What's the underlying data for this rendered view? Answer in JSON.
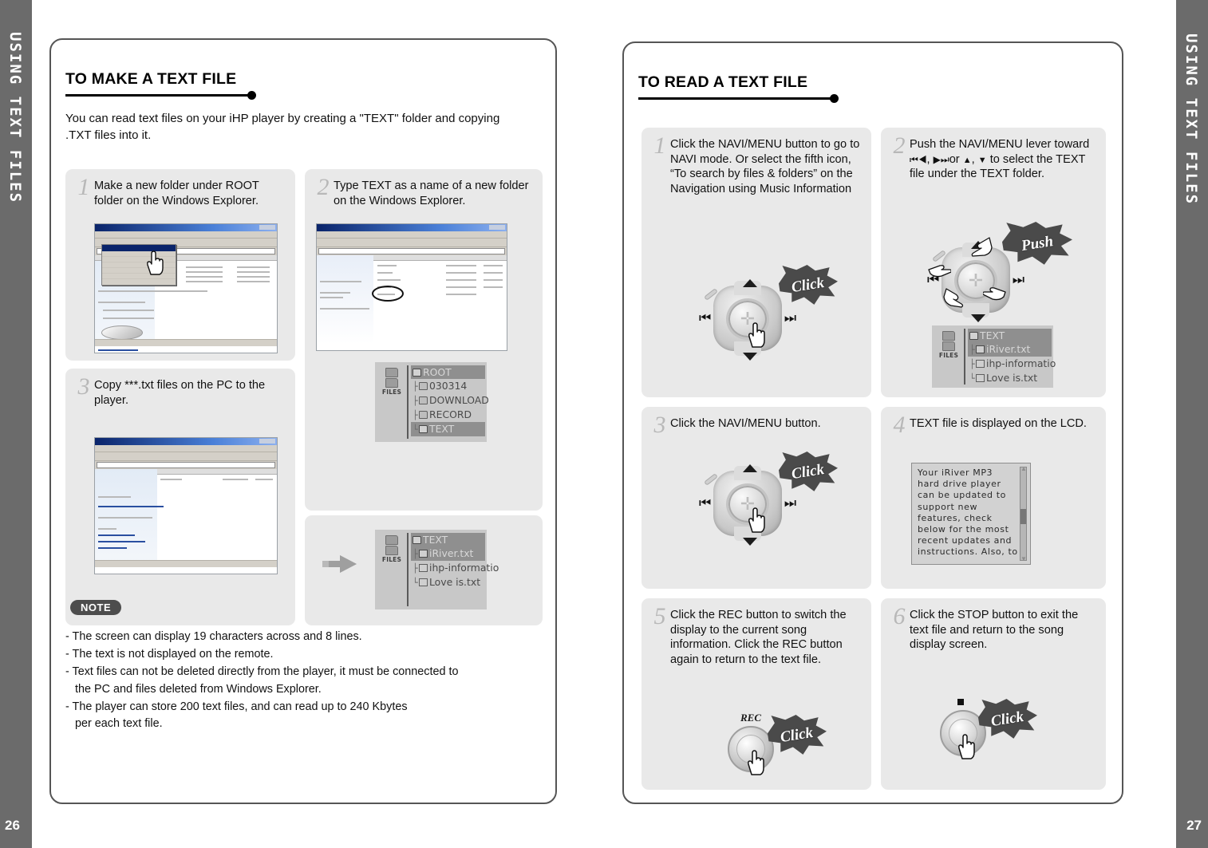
{
  "sidebar": {
    "left_label": "USING TEXT FILES",
    "right_label": "USING TEXT FILES",
    "left_page_number": "26",
    "right_page_number": "27"
  },
  "left_page": {
    "section_title": "TO MAKE A TEXT FILE",
    "intro": "You can read text files on your iHP player by creating a \"TEXT\" folder and copying .TXT files into it.",
    "steps": [
      {
        "num": "1",
        "text": "Make a new folder under ROOT folder on the Windows Explorer."
      },
      {
        "num": "2",
        "text": "Type TEXT as a name of a new folder on the Windows Explorer."
      },
      {
        "num": "3",
        "text": "Copy ***.txt files on the PC to the player."
      }
    ],
    "lcd_root": {
      "files_label": "FILES",
      "rows": [
        {
          "label": "ROOT",
          "selected": true,
          "icon": "folder-open-icon",
          "branch": ""
        },
        {
          "label": "030314",
          "selected": false,
          "icon": "folder-icon",
          "branch": "├"
        },
        {
          "label": "DOWNLOAD",
          "selected": false,
          "icon": "folder-icon",
          "branch": "├"
        },
        {
          "label": "RECORD",
          "selected": false,
          "icon": "folder-icon",
          "branch": "├"
        },
        {
          "label": "TEXT",
          "selected": true,
          "icon": "folder-icon",
          "branch": "└"
        }
      ]
    },
    "lcd_text_folder": {
      "files_label": "FILES",
      "rows": [
        {
          "label": "TEXT",
          "selected": true,
          "icon": "folder-open-icon",
          "branch": ""
        },
        {
          "label": "iRiver.txt",
          "selected": true,
          "icon": "doc-icon",
          "branch": "├"
        },
        {
          "label": "ihp-informatio",
          "selected": false,
          "icon": "doc-icon",
          "branch": "├"
        },
        {
          "label": "Love is.txt",
          "selected": false,
          "icon": "doc-icon",
          "branch": "└"
        }
      ]
    },
    "note": {
      "badge": "NOTE",
      "lines": [
        "- The screen can display 19 characters across and 8 lines.",
        "- The text is not displayed on the remote.",
        "- Text files can not be deleted directly from the player, it must be connected to",
        "   the PC and files deleted from Windows Explorer.",
        "- The player can store 200 text files, and can read up to 240 Kbytes",
        "   per each text file."
      ]
    }
  },
  "right_page": {
    "section_title": "TO READ A TEXT FILE",
    "steps": [
      {
        "num": "1",
        "text": "Click the NAVI/MENU button to go to NAVI mode. Or select the fifth icon, “To search by files & folders” on the Navigation using Music Information",
        "action_label": "Click"
      },
      {
        "num": "2",
        "text_before": "Push the NAVI/MENU lever toward",
        "icons": [
          "skip-prev-icon",
          "rew-icon",
          "ff-icon",
          "skip-next-icon",
          "up-icon",
          "down-icon"
        ],
        "text_mid": "or",
        "text_after": "to select the TEXT file under the TEXT folder.",
        "action_label": "Push"
      },
      {
        "num": "3",
        "text": "Click the NAVI/MENU button.",
        "action_label": "Click"
      },
      {
        "num": "4",
        "text": "TEXT file is displayed on the LCD."
      },
      {
        "num": "5",
        "text": "Click the REC button to switch the display to the current song information. Click the REC button again to return to the text file.",
        "button_cap": "REC",
        "action_label": "Click"
      },
      {
        "num": "6",
        "text": "Click the STOP button to exit the text file and return to the song display screen.",
        "button_cap": "■",
        "action_label": "Click"
      }
    ],
    "lcd_text_folder": {
      "files_label": "FILES",
      "rows": [
        {
          "label": "TEXT",
          "selected": true,
          "icon": "folder-open-icon",
          "branch": ""
        },
        {
          "label": "iRiver.txt",
          "selected": true,
          "icon": "doc-icon",
          "branch": "├"
        },
        {
          "label": "ihp-informatio",
          "selected": false,
          "icon": "doc-icon",
          "branch": "├"
        },
        {
          "label": "Love is.txt",
          "selected": false,
          "icon": "doc-icon",
          "branch": "└"
        }
      ]
    },
    "lcd_reader": {
      "lines": [
        "Your  iRiver  MP3",
        "hard  drive  player",
        "can  be  updated  to",
        "support  new",
        "features,  check",
        "below  for  the  most",
        "recent  updates  and",
        "instructions.  Also, to"
      ]
    }
  },
  "colors": {
    "tab_gray": "#6b6b6b",
    "card_gray": "#e9e9e9",
    "lcd_gray": "#c8c8c8",
    "burst_dark": "#4a4a4a",
    "text_black": "#111111"
  }
}
